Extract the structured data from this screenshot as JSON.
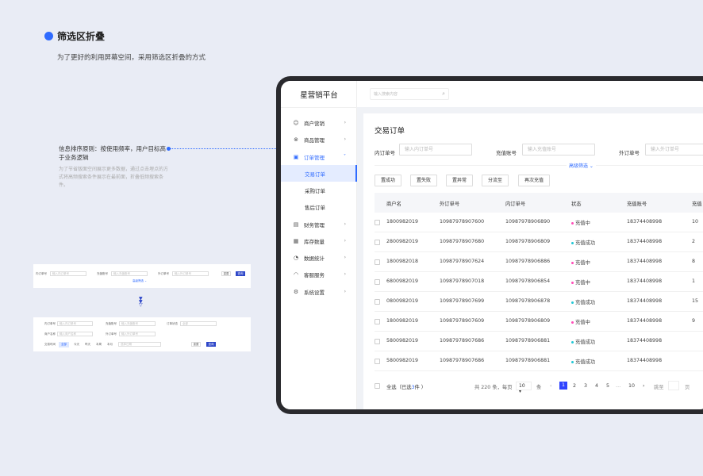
{
  "section": {
    "title": "筛选区折叠",
    "subtitle": "为了更好的利用屏幕空间，采用筛选区折叠的方式"
  },
  "note": {
    "title": "信息排序原则：按使用频率，用户目标高于业务逻辑",
    "body": "为了节省版面空间展示更多数据，通过点击埋点的方式将高频搜索条件展示在最前面，折叠低频搜索条件。"
  },
  "mock_collapsed": {
    "labels": [
      "内订单号",
      "充值账号",
      "外订单号"
    ],
    "placeholders": [
      "输入内订单号",
      "输入充值账号",
      "输入外订单号"
    ],
    "reset": "重置",
    "query": "查询",
    "advanced": "高级筛选 ⌄"
  },
  "mock_expanded": {
    "row1": [
      "内订单号",
      "充值账号",
      "订单状态"
    ],
    "row1_placeholders": [
      "输入内订单号",
      "输入充值账号",
      "全部"
    ],
    "row2": [
      "商户名称",
      "外订单号"
    ],
    "row2_placeholders": [
      "输入商户名称",
      "输入外订单号"
    ],
    "time_label": "交易时间",
    "time_options": [
      "全部",
      "今天",
      "昨天",
      "本周",
      "本月"
    ],
    "date_placeholder": "选择日期",
    "reset": "重置",
    "query": "查询"
  },
  "app": {
    "logo": "星营销平台",
    "search_placeholder": "输入搜索内容"
  },
  "sidebar": {
    "items": [
      {
        "label": "商户营销",
        "icon": "user-icon"
      },
      {
        "label": "商品管理",
        "icon": "box-icon"
      },
      {
        "label": "订单管理",
        "icon": "order-icon"
      },
      {
        "label": "交易订单"
      },
      {
        "label": "采购订单"
      },
      {
        "label": "售后订单"
      },
      {
        "label": "财务管理",
        "icon": "finance-icon"
      },
      {
        "label": "库存数量",
        "icon": "inventory-icon"
      },
      {
        "label": "数据统计",
        "icon": "chart-icon"
      },
      {
        "label": "客服服务",
        "icon": "headset-icon"
      },
      {
        "label": "系统设置",
        "icon": "gear-icon"
      }
    ]
  },
  "page": {
    "title": "交易订单",
    "filters": [
      {
        "label": "内订单号",
        "placeholder": "输入内订单号"
      },
      {
        "label": "充值账号",
        "placeholder": "输入充值账号"
      },
      {
        "label": "外订单号",
        "placeholder": "输入外订单号"
      }
    ],
    "advanced": "高级筛选 ⌄",
    "actions": [
      "置成功",
      "置失败",
      "置异常",
      "分流至",
      "再次充值"
    ],
    "columns": [
      "商户名",
      "外订单号",
      "内订单号",
      "状态",
      "充值账号",
      "充值"
    ],
    "rows": [
      [
        "1800982019",
        "10987978907600",
        "10987978906890",
        "充值中",
        "18374408998",
        "10"
      ],
      [
        "2800982019",
        "10987978907680",
        "10987978906809",
        "充值成功",
        "18374408998",
        "2"
      ],
      [
        "1800982018",
        "10987978907624",
        "10987978906886",
        "充值中",
        "18374408998",
        "8"
      ],
      [
        "6800982019",
        "10987978907018",
        "10987978906854",
        "充值中",
        "18374408998",
        "1"
      ],
      [
        "0800982019",
        "10987978907699",
        "10987978906878",
        "充值成功",
        "18374408998",
        "15"
      ],
      [
        "1800982019",
        "10987978907609",
        "10987978906809",
        "充值中",
        "18374408998",
        "9"
      ],
      [
        "5800982019",
        "10987978907686",
        "10987978906881",
        "充值成功",
        "18374408998",
        ""
      ],
      [
        "5800982019",
        "10987978907686",
        "10987978906881",
        "充值成功",
        "18374408998",
        ""
      ]
    ],
    "footer": {
      "select_all": "全选（已选",
      "selected": "3",
      "unit": "件 ）",
      "total": "共 220 条，每页",
      "page_size": "10 ▾",
      "per": "条",
      "pages": [
        "1",
        "2",
        "3",
        "4",
        "5",
        "…",
        "10"
      ],
      "jump": "跳至",
      "page_unit": "页"
    }
  },
  "colors": {
    "accent": "#2f6bff",
    "pending": "#ff4db8",
    "success": "#22c7d6"
  }
}
